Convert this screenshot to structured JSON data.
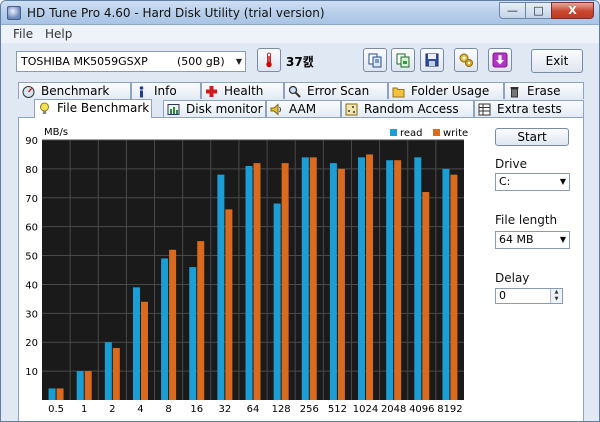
{
  "window": {
    "title": "HD Tune Pro 4.60 - Hard Disk Utility (trial version)",
    "controls": {
      "minimize": "—",
      "maximize": "□",
      "close": "X"
    }
  },
  "menu": {
    "file": "File",
    "help": "Help"
  },
  "toolbar": {
    "drive_name": "TOSHIBA MK5059GSXP",
    "drive_size": "(500 gB)",
    "temperature": "37캜",
    "exit_label": "Exit"
  },
  "tabs_row1": [
    "Benchmark",
    "Info",
    "Health",
    "Error Scan",
    "Folder Usage",
    "Erase"
  ],
  "tabs_row2": [
    "File Benchmark",
    "Disk monitor",
    "AAM",
    "Random Access",
    "Extra tests"
  ],
  "controls": {
    "start_label": "Start",
    "drive_label": "Drive",
    "drive_value": "C:",
    "file_length_label": "File length",
    "file_length_value": "64 MB",
    "delay_label": "Delay",
    "delay_value": "0"
  },
  "colors": {
    "read": "#1b9ed6",
    "write": "#d96a1e",
    "chart_bg": "#1a1a1a",
    "grid": "#4a4a4a"
  },
  "chart_data": {
    "type": "bar",
    "ylabel": "MB/s",
    "ylim": [
      0,
      90
    ],
    "yticks": [
      10,
      20,
      30,
      40,
      50,
      60,
      70,
      80,
      90
    ],
    "categories": [
      "0.5",
      "1",
      "2",
      "4",
      "8",
      "16",
      "32",
      "64",
      "128",
      "256",
      "512",
      "1024",
      "2048",
      "4096",
      "8192"
    ],
    "series": [
      {
        "name": "read",
        "values": [
          4,
          10,
          20,
          39,
          49,
          46,
          78,
          81,
          68,
          84,
          82,
          84,
          83,
          84,
          80
        ]
      },
      {
        "name": "write",
        "values": [
          4,
          10,
          18,
          34,
          52,
          55,
          66,
          82,
          82,
          84,
          80,
          85,
          83,
          72,
          78
        ]
      }
    ],
    "legend": "top-right",
    "grid": true
  }
}
